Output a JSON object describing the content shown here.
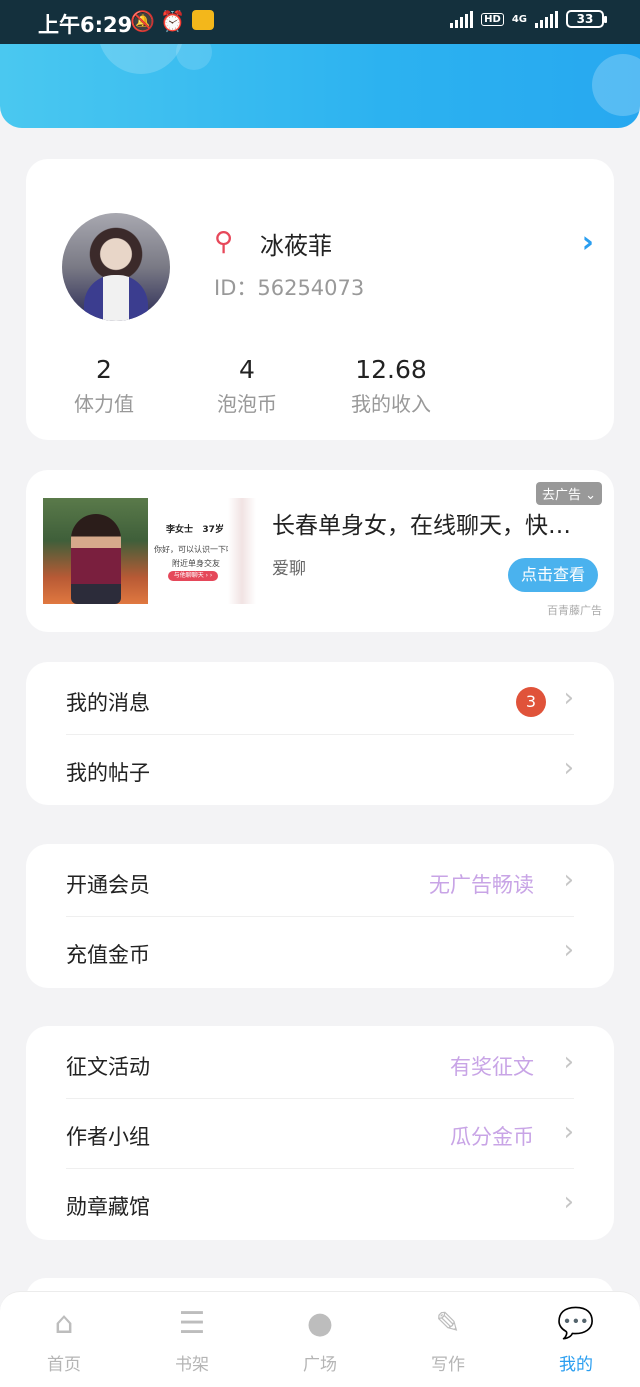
{
  "status": {
    "time": "上午6:29",
    "hd": "HD",
    "network": "4G",
    "battery": "33"
  },
  "profile": {
    "name": "冰莜菲",
    "id_text": "ID：56254073",
    "stats": [
      {
        "value": "2",
        "label": "体力值"
      },
      {
        "value": "4",
        "label": "泡泡币"
      },
      {
        "value": "12.68",
        "label": "我的收入"
      }
    ]
  },
  "ad": {
    "title": "长春单身女，在线聊天，快…",
    "subtitle": "爱聊",
    "close_label": "去广告",
    "cta": "点击查看",
    "source": "百青藤广告",
    "image_name": "李女士",
    "image_age": "37岁",
    "image_line1": "你好，可以认识一下吗?",
    "image_line2": "附近单身交友",
    "image_btn": "与他聊聊天 › ›"
  },
  "menu1": {
    "messages": {
      "label": "我的消息",
      "badge": "3"
    },
    "posts": {
      "label": "我的帖子"
    }
  },
  "menu2": {
    "vip": {
      "label": "开通会员",
      "extra": "无广告畅读"
    },
    "recharge": {
      "label": "充值金币"
    }
  },
  "menu3": {
    "contest": {
      "label": "征文活动",
      "extra": "有奖征文"
    },
    "group": {
      "label": "作者小组",
      "extra": "瓜分金币"
    },
    "medals": {
      "label": "勋章藏馆"
    }
  },
  "tabs": [
    {
      "label": "首页",
      "icon": "home-icon"
    },
    {
      "label": "书架",
      "icon": "bookshelf-icon"
    },
    {
      "label": "广场",
      "icon": "planet-icon"
    },
    {
      "label": "写作",
      "icon": "pen-icon"
    },
    {
      "label": "我的",
      "icon": "chat-bubble-icon"
    }
  ],
  "colors": {
    "accent": "#2a9ef0",
    "badge": "#e0533a",
    "promo_text": "#c8a4e6",
    "gender": "#e7485a"
  }
}
